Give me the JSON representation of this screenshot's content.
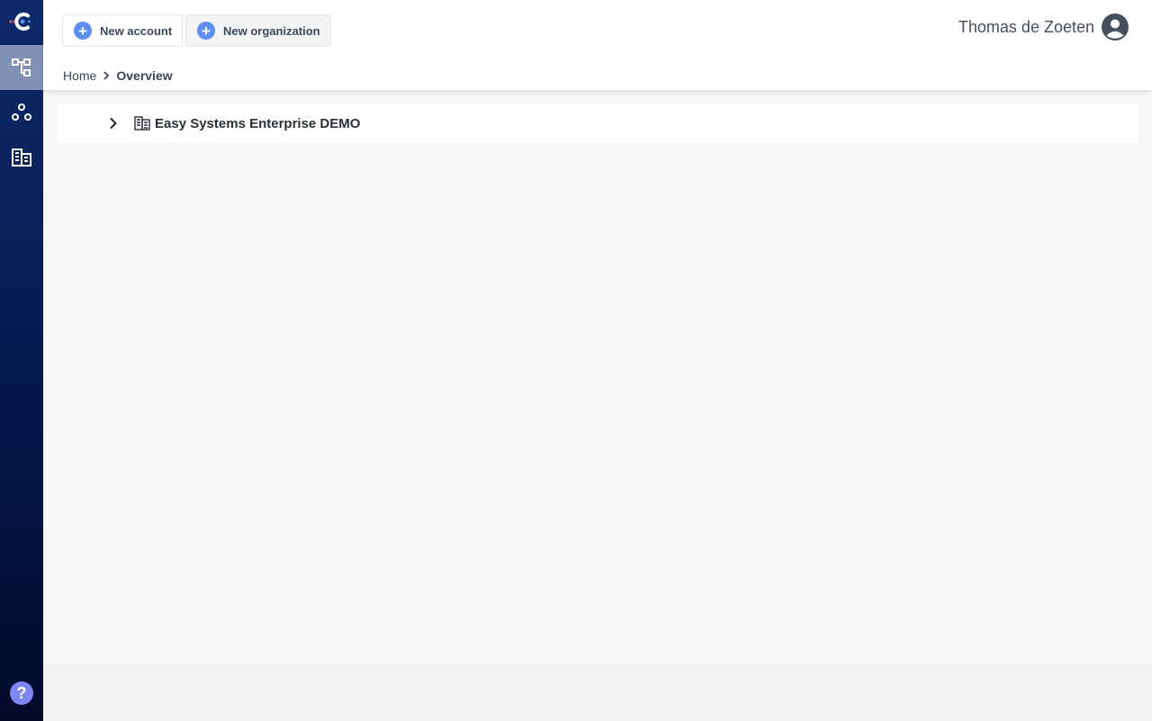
{
  "sidebar": {
    "logo": "logo-icon",
    "items": [
      {
        "name": "hierarchy-icon",
        "active": true
      },
      {
        "name": "groups-icon",
        "active": false
      },
      {
        "name": "organization-icon",
        "active": false
      }
    ],
    "help_label": "?"
  },
  "toolbar": {
    "new_account_label": "New account",
    "new_organization_label": "New organization"
  },
  "user": {
    "name": "Thomas de Zoeten"
  },
  "breadcrumb": {
    "home": "Home",
    "current": "Overview"
  },
  "tree": {
    "items": [
      {
        "label": "Easy Systems Enterprise DEMO",
        "expanded": false
      }
    ]
  },
  "colors": {
    "accent": "#5e8ff0",
    "sidebar_top": "#0e2a6b",
    "sidebar_bottom": "#020a2b",
    "help": "#7b86f0"
  }
}
